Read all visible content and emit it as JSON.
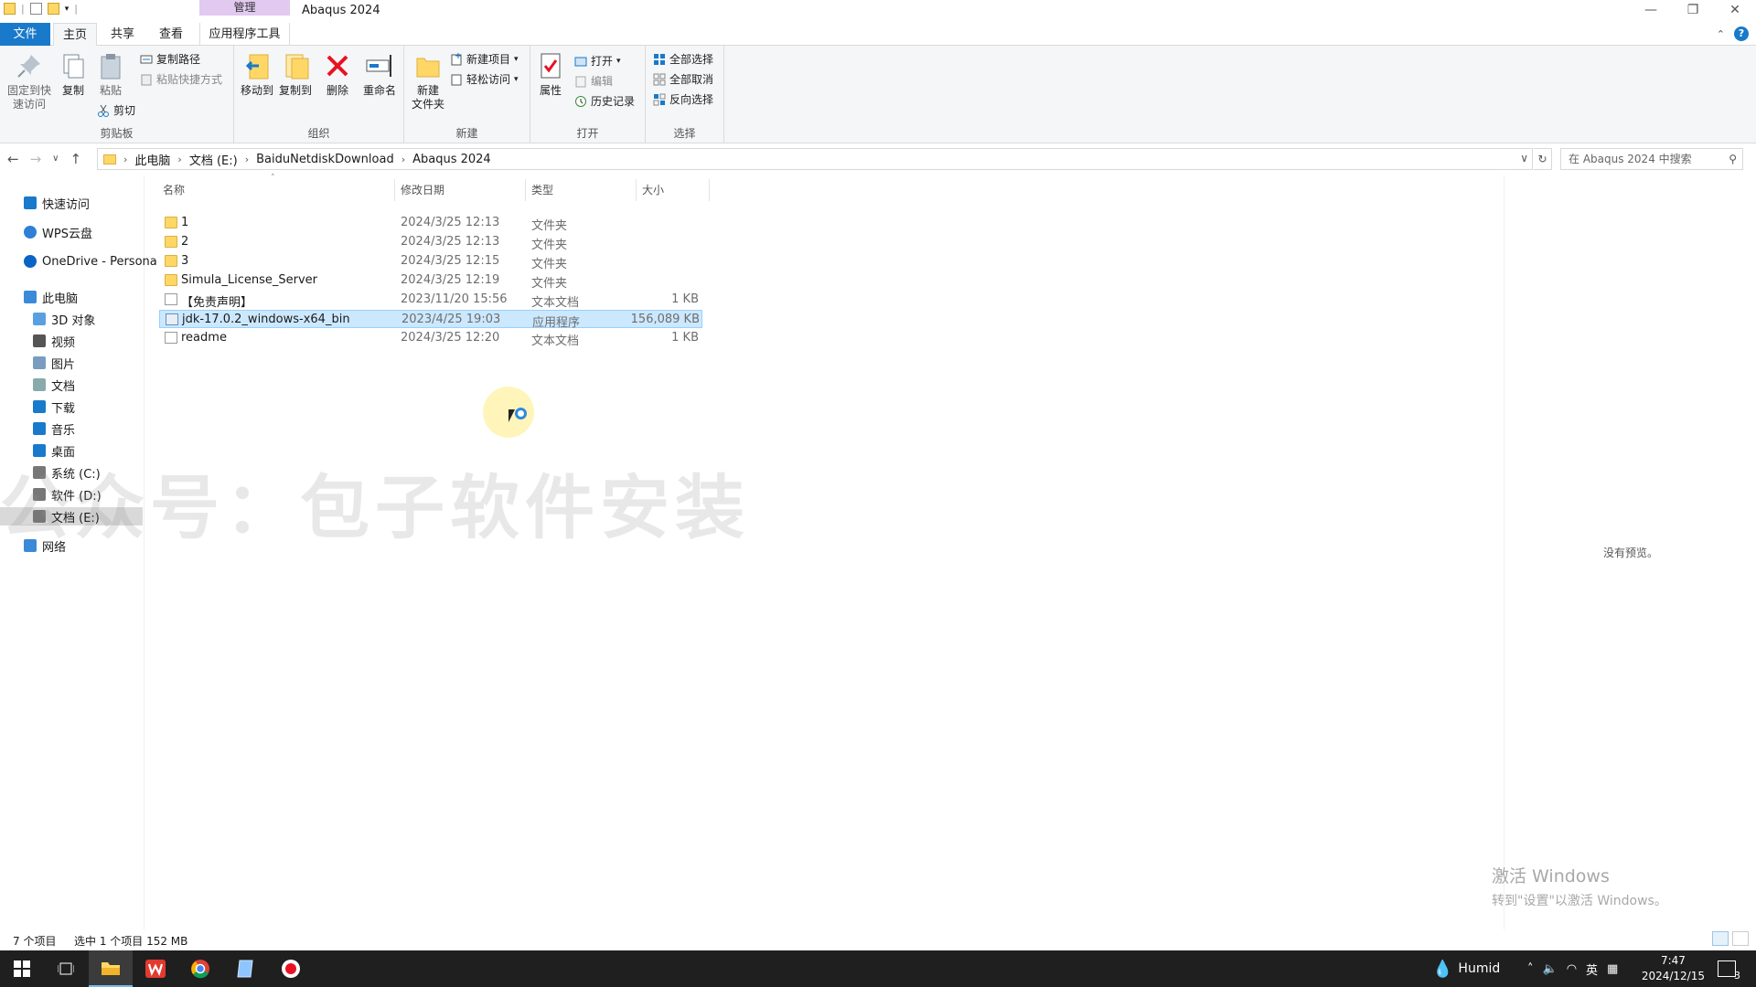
{
  "window": {
    "title": "Abaqus 2024",
    "context_tab": "管理",
    "controls": [
      "—",
      "❐",
      "✕"
    ]
  },
  "tabs": {
    "file": "文件",
    "home": "主页",
    "share": "共享",
    "view": "查看",
    "app_tools": "应用程序工具"
  },
  "ribbon": {
    "clipboard": {
      "pin": "固定到快\n速访问",
      "copy": "复制",
      "paste": "粘贴",
      "copy_path": "复制路径",
      "paste_shortcut": "粘贴快捷方式",
      "cut": "剪切",
      "label": "剪贴板"
    },
    "organize": {
      "move_to": "移动到",
      "copy_to": "复制到",
      "delete": "删除",
      "rename": "重命名",
      "label": "组织"
    },
    "new": {
      "new_folder": "新建\n文件夹",
      "new_item": "新建项目",
      "easy_access": "轻松访问",
      "label": "新建"
    },
    "open": {
      "properties": "属性",
      "open": "打开",
      "edit": "编辑",
      "history": "历史记录",
      "label": "打开"
    },
    "select": {
      "select_all": "全部选择",
      "select_none": "全部取消",
      "invert": "反向选择",
      "label": "选择"
    }
  },
  "address": {
    "crumbs": [
      "此电脑",
      "文档 (E:)",
      "BaiduNetdiskDownload",
      "Abaqus 2024"
    ],
    "search_placeholder": "在 Abaqus 2024 中搜索"
  },
  "sidebar": {
    "items": [
      {
        "label": "快速访问",
        "icon": "star-icon"
      },
      {
        "label": "WPS云盘",
        "icon": "cloud-icon"
      },
      {
        "label": "OneDrive - Persona",
        "icon": "onedrive-icon"
      },
      {
        "label": "此电脑",
        "icon": "pc-icon"
      },
      {
        "label": "3D 对象",
        "icon": "cube-icon"
      },
      {
        "label": "视频",
        "icon": "video-icon"
      },
      {
        "label": "图片",
        "icon": "picture-icon"
      },
      {
        "label": "文档",
        "icon": "document-icon"
      },
      {
        "label": "下载",
        "icon": "download-icon"
      },
      {
        "label": "音乐",
        "icon": "music-icon"
      },
      {
        "label": "桌面",
        "icon": "desktop-icon"
      },
      {
        "label": "系统 (C:)",
        "icon": "drive-icon"
      },
      {
        "label": "软件 (D:)",
        "icon": "drive-icon"
      },
      {
        "label": "文档 (E:)",
        "icon": "drive-icon"
      },
      {
        "label": "网络",
        "icon": "network-icon"
      }
    ]
  },
  "columns": {
    "name": "名称",
    "date": "修改日期",
    "type": "类型",
    "size": "大小"
  },
  "files": [
    {
      "name": "1",
      "date": "2024/3/25 12:13",
      "type": "文件夹",
      "size": "",
      "icon": "folder"
    },
    {
      "name": "2",
      "date": "2024/3/25 12:13",
      "type": "文件夹",
      "size": "",
      "icon": "folder"
    },
    {
      "name": "3",
      "date": "2024/3/25 12:15",
      "type": "文件夹",
      "size": "",
      "icon": "folder"
    },
    {
      "name": "Simula_License_Server",
      "date": "2024/3/25 12:19",
      "type": "文件夹",
      "size": "",
      "icon": "folder"
    },
    {
      "name": "【免责声明】",
      "date": "2023/11/20 15:56",
      "type": "文本文档",
      "size": "1 KB",
      "icon": "doc"
    },
    {
      "name": "jdk-17.0.2_windows-x64_bin",
      "date": "2023/4/25 19:03",
      "type": "应用程序",
      "size": "156,089 KB",
      "icon": "app"
    },
    {
      "name": "readme",
      "date": "2024/3/25 12:20",
      "type": "文本文档",
      "size": "1 KB",
      "icon": "doc"
    }
  ],
  "preview": {
    "text": "没有预览。"
  },
  "watermark": "公众号：包子软件安装",
  "activation": {
    "line1": "激活 Windows",
    "line2": "转到\"设置\"以激活 Windows。"
  },
  "status": {
    "count": "7 个项目",
    "selected": "选中 1 个项目  152 MB"
  },
  "taskbar": {
    "weather": "Humid",
    "ime": "英",
    "time": "7:47",
    "date": "2024/12/15",
    "notifications": "3"
  },
  "colors": {
    "accent": "#1979ca",
    "selection": "#cce8ff",
    "manage_tab": "#e2c9f0",
    "taskbar": "#1f1f1f"
  }
}
